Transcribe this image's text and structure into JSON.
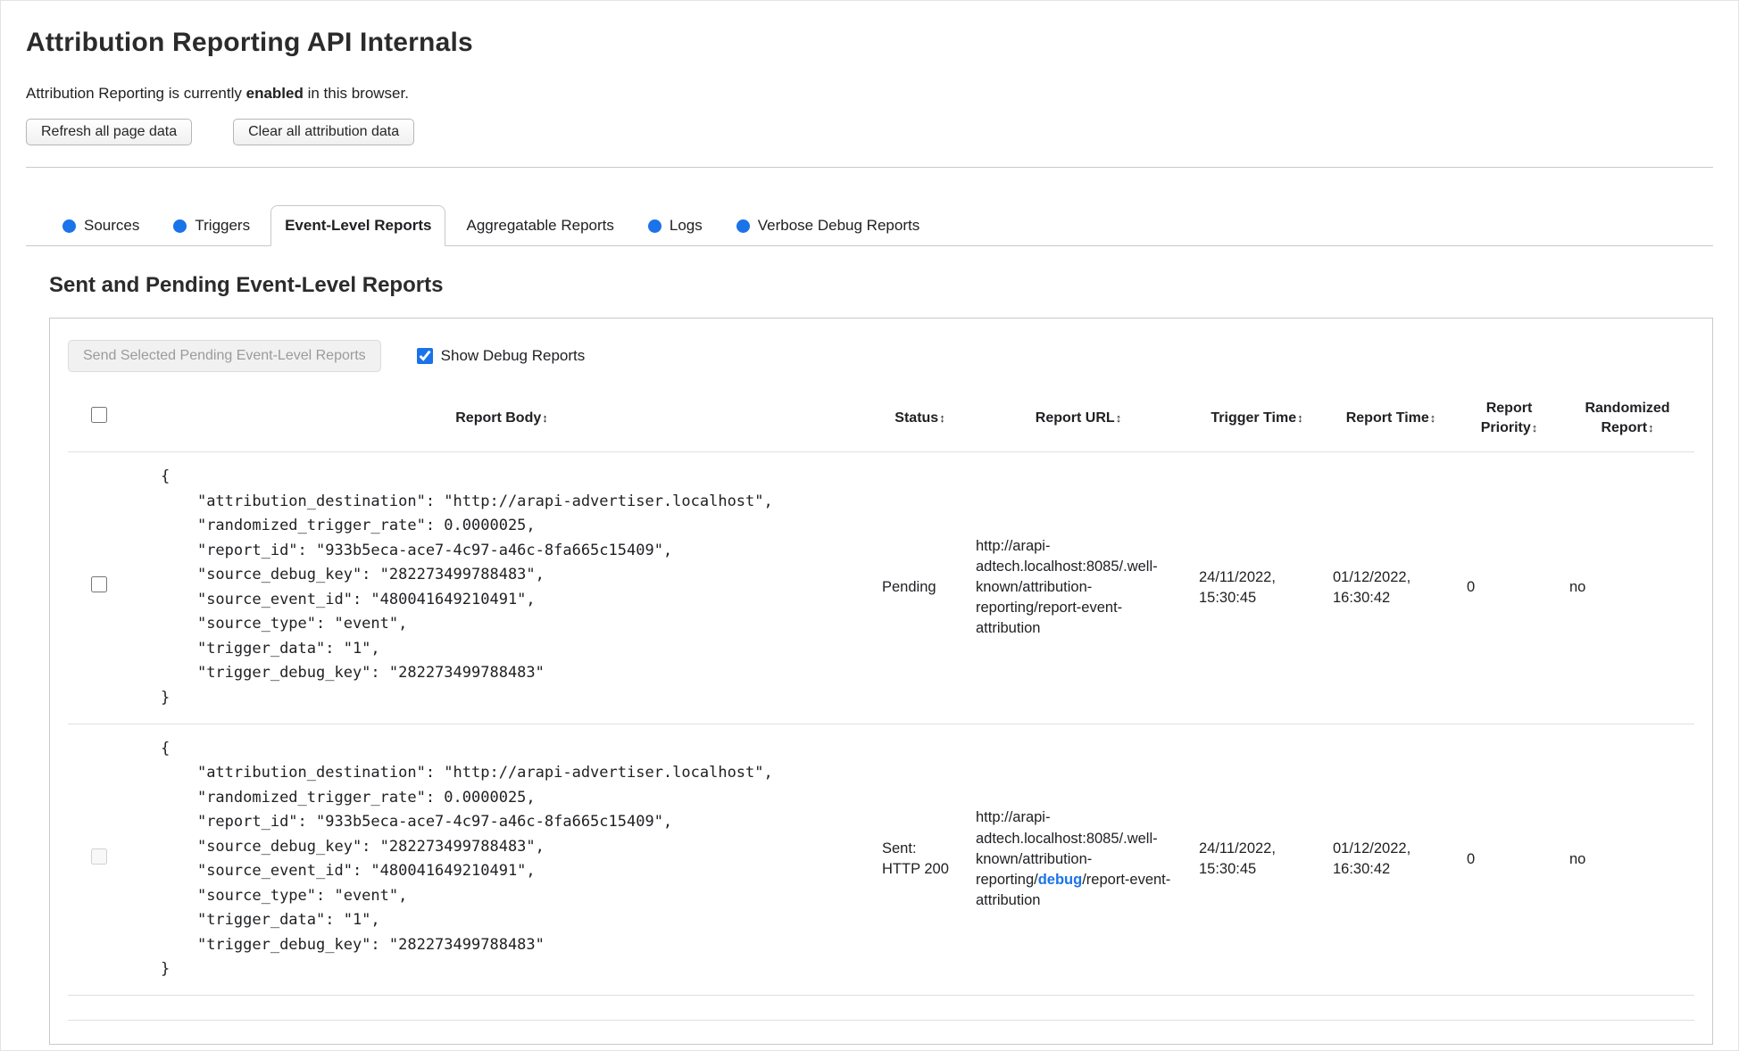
{
  "header": {
    "title": "Attribution Reporting API Internals",
    "status_prefix": "Attribution Reporting is currently ",
    "status_bold": "enabled",
    "status_suffix": " in this browser.",
    "refresh_button": "Refresh all page data",
    "clear_button": "Clear all attribution data"
  },
  "colors": {
    "accent_blue": "#1a73e8"
  },
  "tabs": [
    {
      "label": "Sources"
    },
    {
      "label": "Triggers"
    },
    {
      "label": "Event-Level Reports"
    },
    {
      "label": "Aggregatable Reports"
    },
    {
      "label": "Logs"
    },
    {
      "label": "Verbose Debug Reports"
    }
  ],
  "section": {
    "heading": "Sent and Pending Event-Level Reports",
    "send_button_label": "Send Selected Pending Event-Level Reports",
    "show_debug_label": "Show Debug Reports",
    "show_debug_checked": true
  },
  "table": {
    "sort_icon": "↕",
    "columns": {
      "report_body": "Report Body",
      "status": "Status",
      "report_url": "Report URL",
      "trigger_time": "Trigger Time",
      "report_time": "Report Time",
      "report_priority": "Report Priority",
      "randomized_report": "Randomized Report"
    },
    "rows": [
      {
        "report_body": "{\n    \"attribution_destination\": \"http://arapi-advertiser.localhost\",\n    \"randomized_trigger_rate\": 0.0000025,\n    \"report_id\": \"933b5eca-ace7-4c97-a46c-8fa665c15409\",\n    \"source_debug_key\": \"282273499788483\",\n    \"source_event_id\": \"480041649210491\",\n    \"source_type\": \"event\",\n    \"trigger_data\": \"1\",\n    \"trigger_debug_key\": \"282273499788483\"\n}",
        "status": "Pending",
        "url_prefix": "http://arapi-adtech.localhost:8085/.well-known/attribution-reporting/report-event-attribution",
        "url_highlight": "",
        "url_suffix": "",
        "trigger_time": "24/11/2022, 15:30:45",
        "report_time": "01/12/2022, 16:30:42",
        "report_priority": "0",
        "randomized_report": "no"
      },
      {
        "report_body": "{\n    \"attribution_destination\": \"http://arapi-advertiser.localhost\",\n    \"randomized_trigger_rate\": 0.0000025,\n    \"report_id\": \"933b5eca-ace7-4c97-a46c-8fa665c15409\",\n    \"source_debug_key\": \"282273499788483\",\n    \"source_event_id\": \"480041649210491\",\n    \"source_type\": \"event\",\n    \"trigger_data\": \"1\",\n    \"trigger_debug_key\": \"282273499788483\"\n}",
        "status": "Sent: HTTP 200",
        "url_prefix": "http://arapi-adtech.localhost:8085/.well-known/attribution-reporting/",
        "url_highlight": "debug",
        "url_suffix": "/report-event-attribution",
        "trigger_time": "24/11/2022, 15:30:45",
        "report_time": "01/12/2022, 16:30:42",
        "report_priority": "0",
        "randomized_report": "no"
      }
    ]
  }
}
